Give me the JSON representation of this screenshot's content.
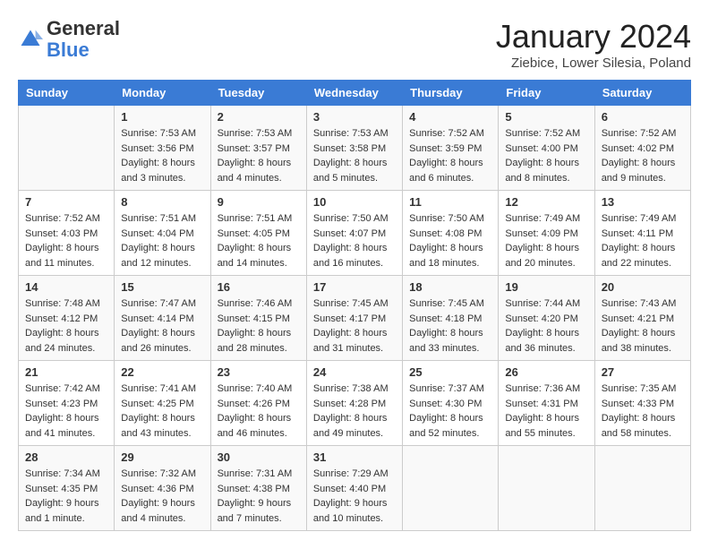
{
  "header": {
    "logo_general": "General",
    "logo_blue": "Blue",
    "month": "January 2024",
    "location": "Ziebice, Lower Silesia, Poland"
  },
  "days_of_week": [
    "Sunday",
    "Monday",
    "Tuesday",
    "Wednesday",
    "Thursday",
    "Friday",
    "Saturday"
  ],
  "weeks": [
    [
      {
        "day": "",
        "content": ""
      },
      {
        "day": "1",
        "content": "Sunrise: 7:53 AM\nSunset: 3:56 PM\nDaylight: 8 hours\nand 3 minutes."
      },
      {
        "day": "2",
        "content": "Sunrise: 7:53 AM\nSunset: 3:57 PM\nDaylight: 8 hours\nand 4 minutes."
      },
      {
        "day": "3",
        "content": "Sunrise: 7:53 AM\nSunset: 3:58 PM\nDaylight: 8 hours\nand 5 minutes."
      },
      {
        "day": "4",
        "content": "Sunrise: 7:52 AM\nSunset: 3:59 PM\nDaylight: 8 hours\nand 6 minutes."
      },
      {
        "day": "5",
        "content": "Sunrise: 7:52 AM\nSunset: 4:00 PM\nDaylight: 8 hours\nand 8 minutes."
      },
      {
        "day": "6",
        "content": "Sunrise: 7:52 AM\nSunset: 4:02 PM\nDaylight: 8 hours\nand 9 minutes."
      }
    ],
    [
      {
        "day": "7",
        "content": "Sunrise: 7:52 AM\nSunset: 4:03 PM\nDaylight: 8 hours\nand 11 minutes."
      },
      {
        "day": "8",
        "content": "Sunrise: 7:51 AM\nSunset: 4:04 PM\nDaylight: 8 hours\nand 12 minutes."
      },
      {
        "day": "9",
        "content": "Sunrise: 7:51 AM\nSunset: 4:05 PM\nDaylight: 8 hours\nand 14 minutes."
      },
      {
        "day": "10",
        "content": "Sunrise: 7:50 AM\nSunset: 4:07 PM\nDaylight: 8 hours\nand 16 minutes."
      },
      {
        "day": "11",
        "content": "Sunrise: 7:50 AM\nSunset: 4:08 PM\nDaylight: 8 hours\nand 18 minutes."
      },
      {
        "day": "12",
        "content": "Sunrise: 7:49 AM\nSunset: 4:09 PM\nDaylight: 8 hours\nand 20 minutes."
      },
      {
        "day": "13",
        "content": "Sunrise: 7:49 AM\nSunset: 4:11 PM\nDaylight: 8 hours\nand 22 minutes."
      }
    ],
    [
      {
        "day": "14",
        "content": "Sunrise: 7:48 AM\nSunset: 4:12 PM\nDaylight: 8 hours\nand 24 minutes."
      },
      {
        "day": "15",
        "content": "Sunrise: 7:47 AM\nSunset: 4:14 PM\nDaylight: 8 hours\nand 26 minutes."
      },
      {
        "day": "16",
        "content": "Sunrise: 7:46 AM\nSunset: 4:15 PM\nDaylight: 8 hours\nand 28 minutes."
      },
      {
        "day": "17",
        "content": "Sunrise: 7:45 AM\nSunset: 4:17 PM\nDaylight: 8 hours\nand 31 minutes."
      },
      {
        "day": "18",
        "content": "Sunrise: 7:45 AM\nSunset: 4:18 PM\nDaylight: 8 hours\nand 33 minutes."
      },
      {
        "day": "19",
        "content": "Sunrise: 7:44 AM\nSunset: 4:20 PM\nDaylight: 8 hours\nand 36 minutes."
      },
      {
        "day": "20",
        "content": "Sunrise: 7:43 AM\nSunset: 4:21 PM\nDaylight: 8 hours\nand 38 minutes."
      }
    ],
    [
      {
        "day": "21",
        "content": "Sunrise: 7:42 AM\nSunset: 4:23 PM\nDaylight: 8 hours\nand 41 minutes."
      },
      {
        "day": "22",
        "content": "Sunrise: 7:41 AM\nSunset: 4:25 PM\nDaylight: 8 hours\nand 43 minutes."
      },
      {
        "day": "23",
        "content": "Sunrise: 7:40 AM\nSunset: 4:26 PM\nDaylight: 8 hours\nand 46 minutes."
      },
      {
        "day": "24",
        "content": "Sunrise: 7:38 AM\nSunset: 4:28 PM\nDaylight: 8 hours\nand 49 minutes."
      },
      {
        "day": "25",
        "content": "Sunrise: 7:37 AM\nSunset: 4:30 PM\nDaylight: 8 hours\nand 52 minutes."
      },
      {
        "day": "26",
        "content": "Sunrise: 7:36 AM\nSunset: 4:31 PM\nDaylight: 8 hours\nand 55 minutes."
      },
      {
        "day": "27",
        "content": "Sunrise: 7:35 AM\nSunset: 4:33 PM\nDaylight: 8 hours\nand 58 minutes."
      }
    ],
    [
      {
        "day": "28",
        "content": "Sunrise: 7:34 AM\nSunset: 4:35 PM\nDaylight: 9 hours\nand 1 minute."
      },
      {
        "day": "29",
        "content": "Sunrise: 7:32 AM\nSunset: 4:36 PM\nDaylight: 9 hours\nand 4 minutes."
      },
      {
        "day": "30",
        "content": "Sunrise: 7:31 AM\nSunset: 4:38 PM\nDaylight: 9 hours\nand 7 minutes."
      },
      {
        "day": "31",
        "content": "Sunrise: 7:29 AM\nSunset: 4:40 PM\nDaylight: 9 hours\nand 10 minutes."
      },
      {
        "day": "",
        "content": ""
      },
      {
        "day": "",
        "content": ""
      },
      {
        "day": "",
        "content": ""
      }
    ]
  ]
}
